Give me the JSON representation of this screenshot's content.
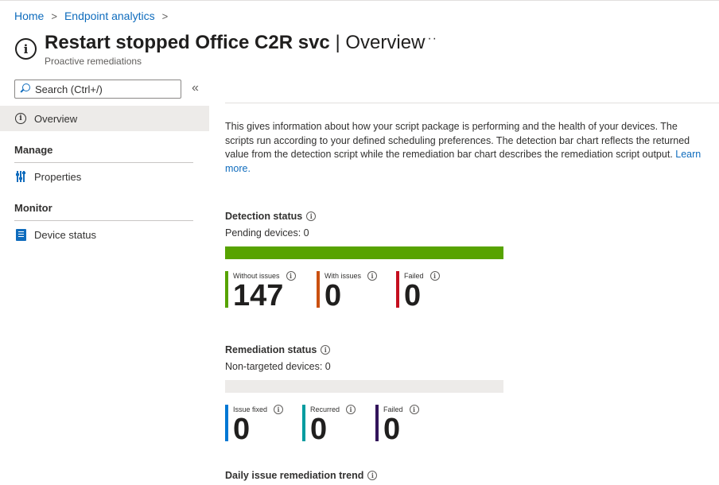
{
  "breadcrumb": {
    "items": [
      "Home",
      "Endpoint analytics"
    ]
  },
  "header": {
    "title_main": "Restart stopped Office C2R svc",
    "title_sep": " | ",
    "title_sub": "Overview",
    "subtitle": "Proactive remediations",
    "more_label": "···",
    "icon": "info-icon"
  },
  "sidebar": {
    "search_placeholder": "Search (Ctrl+/)",
    "collapse_label": "«",
    "overview_label": "Overview",
    "sections": [
      {
        "title": "Manage",
        "items": [
          {
            "label": "Properties",
            "icon": "properties-icon"
          }
        ]
      },
      {
        "title": "Monitor",
        "items": [
          {
            "label": "Device status",
            "icon": "device-status-icon"
          }
        ]
      }
    ]
  },
  "main": {
    "intro_text": "This gives information about how your script package is performing and the health of your devices. The scripts run according to your defined scheduling preferences. The detection bar chart reflects the returned value from the detection script while the remediation bar chart describes the remediation script output.",
    "learn_more": "Learn more.",
    "detection": {
      "title": "Detection status",
      "pending": "Pending devices: 0",
      "bar_fill_fraction": 1.0,
      "bar_color": "#57a300",
      "metrics": [
        {
          "label": "Without issues",
          "value": "147",
          "color": "#57a300"
        },
        {
          "label": "With issues",
          "value": "0",
          "color": "#ca5010"
        },
        {
          "label": "Failed",
          "value": "0",
          "color": "#c50f1f"
        }
      ]
    },
    "remediation": {
      "title": "Remediation status",
      "non_targeted": "Non-targeted devices: 0",
      "bar_fill_fraction": 0,
      "metrics": [
        {
          "label": "Issue fixed",
          "value": "0",
          "color": "#0078d4"
        },
        {
          "label": "Recurred",
          "value": "0",
          "color": "#009ca0"
        },
        {
          "label": "Failed",
          "value": "0",
          "color": "#32145a"
        }
      ]
    },
    "trend": {
      "title": "Daily issue remediation trend"
    }
  }
}
